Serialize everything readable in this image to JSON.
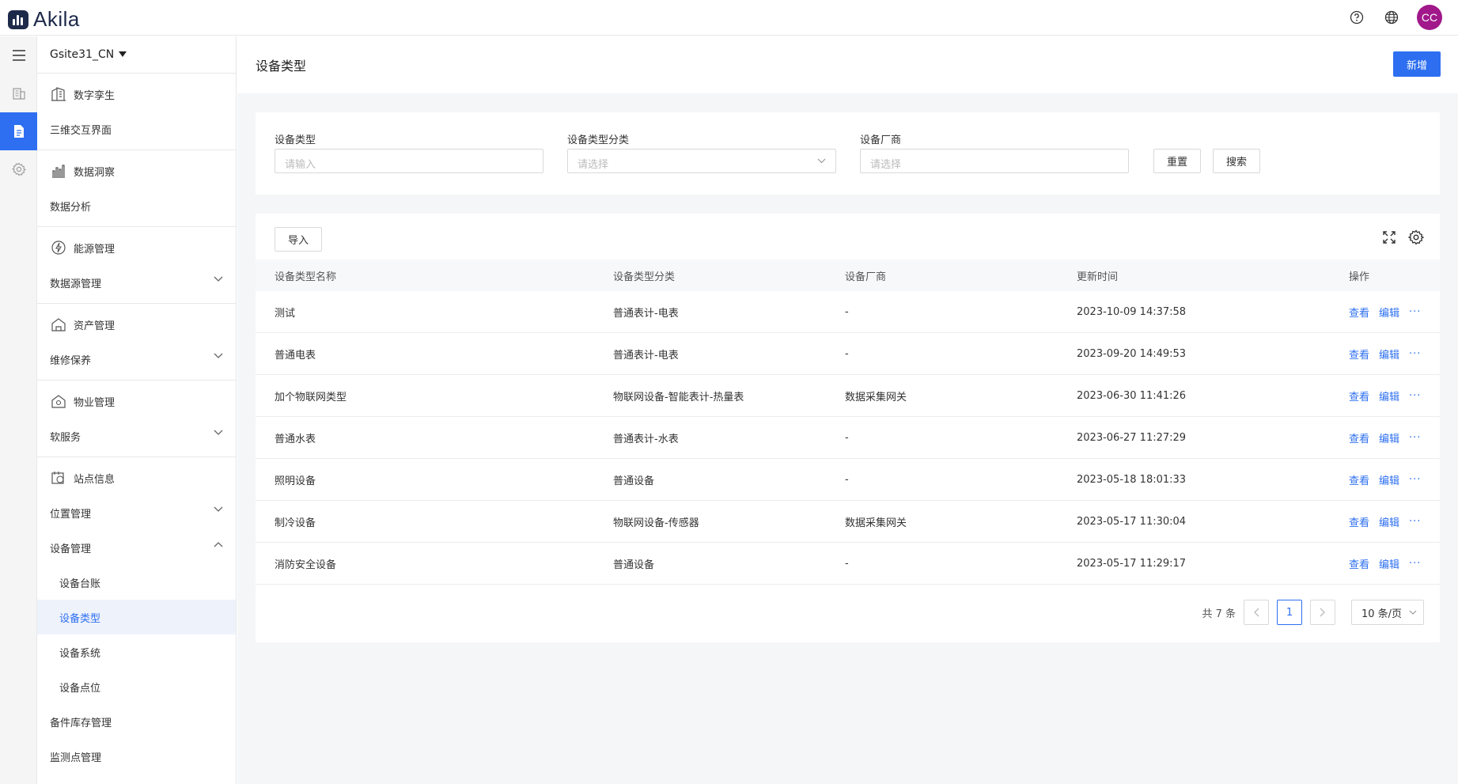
{
  "app": {
    "logo_text": "Akila",
    "avatar": "CC"
  },
  "topbar": {
    "icons": [
      "help-icon",
      "globe-icon"
    ]
  },
  "rail": {
    "icons": [
      "menu-icon",
      "building-icon",
      "document-icon",
      "gear-icon"
    ]
  },
  "sidebar": {
    "site": "Gsite31_CN",
    "groups": [
      {
        "title": "数字孪生",
        "items": [
          "三维交互界面"
        ]
      },
      {
        "title": "数据洞察",
        "items": [
          "数据分析"
        ]
      },
      {
        "title": "能源管理",
        "items": [
          "数据源管理"
        ]
      },
      {
        "title": "资产管理",
        "items": [
          "维修保养"
        ]
      },
      {
        "title": "物业管理",
        "items": [
          "软服务"
        ]
      },
      {
        "title": "站点信息",
        "items": [
          "位置管理",
          "设备管理",
          "设备台账",
          "设备类型",
          "设备系统",
          "设备点位",
          "备件库存管理",
          "监测点管理"
        ]
      }
    ]
  },
  "page": {
    "title": "设备类型",
    "add_button": "新增"
  },
  "filter": {
    "type_label": "设备类型",
    "type_placeholder": "请输入",
    "category_label": "设备类型分类",
    "category_placeholder": "请选择",
    "vendor_label": "设备厂商",
    "vendor_placeholder": "请选择",
    "reset": "重置",
    "search": "搜索"
  },
  "table": {
    "import": "导入",
    "columns": [
      "设备类型名称",
      "设备类型分类",
      "设备厂商",
      "更新时间",
      "操作"
    ],
    "rows": [
      {
        "name": "测试",
        "category": "普通表计-电表",
        "vendor": "-",
        "updated": "2023-10-09 14:37:58"
      },
      {
        "name": "普通电表",
        "category": "普通表计-电表",
        "vendor": "-",
        "updated": "2023-09-20 14:49:53"
      },
      {
        "name": "加个物联网类型",
        "category": "物联网设备-智能表计-热量表",
        "vendor": "数据采集网关",
        "updated": "2023-06-30 11:41:26"
      },
      {
        "name": "普通水表",
        "category": "普通表计-水表",
        "vendor": "-",
        "updated": "2023-06-27 11:27:29"
      },
      {
        "name": "照明设备",
        "category": "普通设备",
        "vendor": "-",
        "updated": "2023-05-18 18:01:33"
      },
      {
        "name": "制冷设备",
        "category": "物联网设备-传感器",
        "vendor": "数据采集网关",
        "updated": "2023-05-17 11:30:04"
      },
      {
        "name": "消防安全设备",
        "category": "普通设备",
        "vendor": "-",
        "updated": "2023-05-17 11:29:17"
      }
    ],
    "op_view": "查看",
    "op_edit": "编辑",
    "op_more": "···"
  },
  "pagination": {
    "total": "共 7 条",
    "current": "1",
    "page_size": "10 条/页"
  },
  "colors": {
    "accent": "#2d6ff0",
    "avatar": "#a0188a"
  }
}
